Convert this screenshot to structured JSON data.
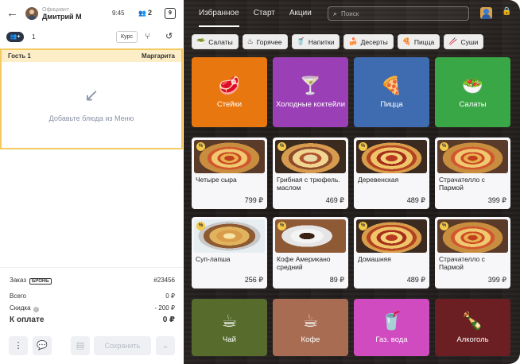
{
  "header": {
    "back_icon": "arrow-left-icon",
    "waiter_role": "Официант",
    "waiter_name": "Дмитрий М",
    "time": "9:45",
    "guests_count": "2",
    "table_number": "9"
  },
  "toolbar": {
    "guest_count_value": "1",
    "course_label": "Курс",
    "add_guest_label": "+"
  },
  "guest": {
    "name": "Гость 1",
    "table_name": "Маргарита",
    "empty_text": "Добавьте блюда из Меню"
  },
  "summary": {
    "order_label": "Заказ",
    "bron_label": "БРОНЬ",
    "order_number": "#23456",
    "total_label": "Всего",
    "total_value": "0 ₽",
    "discount_label": "Скидка",
    "discount_value": "- 200 ₽",
    "pay_label": "К оплате",
    "pay_value": "0 ₽",
    "save_label": "Сохранить"
  },
  "menu": {
    "tabs": [
      {
        "label": "Избранное",
        "active": true
      },
      {
        "label": "Старт",
        "active": false
      },
      {
        "label": "Акции",
        "active": false
      }
    ],
    "search_placeholder": "Поиск",
    "categories": [
      {
        "label": "Салаты",
        "icon": "salad-bowl-icon"
      },
      {
        "label": "Горячее",
        "icon": "hot-dish-icon"
      },
      {
        "label": "Напитки",
        "icon": "drink-icon"
      },
      {
        "label": "Десерты",
        "icon": "cake-icon"
      },
      {
        "label": "Пицца",
        "icon": "pizza-icon"
      },
      {
        "label": "Суши",
        "icon": "sushi-icon"
      }
    ],
    "top_tiles": [
      {
        "label": "Стейки",
        "color": "#e8770f",
        "icon": "steak-icon"
      },
      {
        "label": "Холодные коктейли",
        "color": "#9a3fb5",
        "icon": "cocktail-icon"
      },
      {
        "label": "Пицца",
        "color": "#3f6bb0",
        "icon": "pizza-icon"
      },
      {
        "label": "Салаты",
        "color": "#3aa746",
        "icon": "salad-icon"
      }
    ],
    "dishes": [
      {
        "name": "Четыре сыра",
        "price": "799 ₽",
        "discount": true
      },
      {
        "name": "Грибная с трюфель. маслом",
        "price": "469 ₽",
        "discount": true
      },
      {
        "name": "Деревенская",
        "price": "489 ₽",
        "discount": true
      },
      {
        "name": "Страчателло с Пармой",
        "price": "399 ₽",
        "discount": true
      },
      {
        "name": "Суп-лапша",
        "price": "256 ₽",
        "discount": true
      },
      {
        "name": "Кофе Американо средний",
        "price": "89 ₽",
        "discount": true
      },
      {
        "name": "Домашняя",
        "price": "489 ₽",
        "discount": true
      },
      {
        "name": "Страчателло с Пармой",
        "price": "399 ₽",
        "discount": true
      }
    ],
    "bottom_tiles": [
      {
        "label": "Чай",
        "color": "#566b2c",
        "icon": "tea-cup-icon"
      },
      {
        "label": "Кофе",
        "color": "#a86c52",
        "icon": "coffee-cup-icon"
      },
      {
        "label": "Газ. вода",
        "color": "#d04ac0",
        "icon": "soda-icon"
      },
      {
        "label": "Алкоголь",
        "color": "#6b1f22",
        "icon": "bottle-icon"
      }
    ],
    "discount_badge": "%"
  }
}
